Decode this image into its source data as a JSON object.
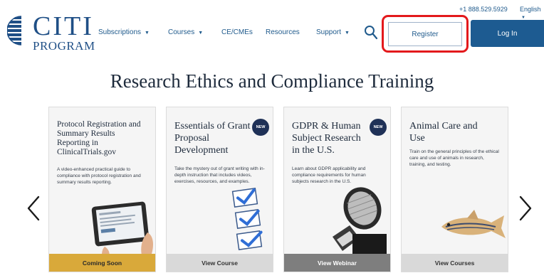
{
  "header": {
    "phone": "+1 888.529.5929",
    "language": "English",
    "logo": {
      "line1": "CITI",
      "line2": "PROGRAM"
    },
    "nav": [
      {
        "label": "Subscriptions",
        "has_dropdown": true
      },
      {
        "label": "Courses",
        "has_dropdown": true
      },
      {
        "label": "CE/CMEs",
        "has_dropdown": false
      },
      {
        "label": "Resources",
        "has_dropdown": false
      },
      {
        "label": "Support",
        "has_dropdown": true
      }
    ],
    "register_label": "Register",
    "login_label": "Log In"
  },
  "main": {
    "headline": "Research Ethics and Compliance Training",
    "cards": [
      {
        "title": "Protocol Registration and Summary Results Reporting in ClinicalTrials.gov",
        "description": "A video-enhanced practical guide to compliance with protocol registration and summary results reporting.",
        "button": "Coming Soon",
        "is_new": false,
        "illustration": "tablet-icon"
      },
      {
        "title": "Essentials of Grant Proposal Development",
        "description": "Take the mystery out of grant writing with in-depth instruction that includes videos, exercises, resources, and examples.",
        "button": "View Course",
        "is_new": true,
        "badge": "NEW",
        "illustration": "checklist-icon"
      },
      {
        "title": "GDPR & Human Subject Research in the U.S.",
        "description": "Learn about GDPR applicability and compliance requirements for human subjects research in the U.S.",
        "button": "View Webinar",
        "is_new": true,
        "badge": "NEW",
        "illustration": "microphone-icon"
      },
      {
        "title": "Animal Care and Use",
        "description": "Train on the general principles of the ethical care and use of animals in research, training, and testing.",
        "button": "View Courses",
        "is_new": false,
        "illustration": "zebrafish-icon"
      }
    ]
  },
  "colors": {
    "brand_blue": "#1f4f86",
    "login_bg": "#1d5b91",
    "highlight_red": "#e3191c",
    "coming_soon_bg": "#d9a93a",
    "webinar_bg": "#7e7e7e",
    "view_course_bg": "#d9d9d9",
    "badge_bg": "#1f3157"
  }
}
